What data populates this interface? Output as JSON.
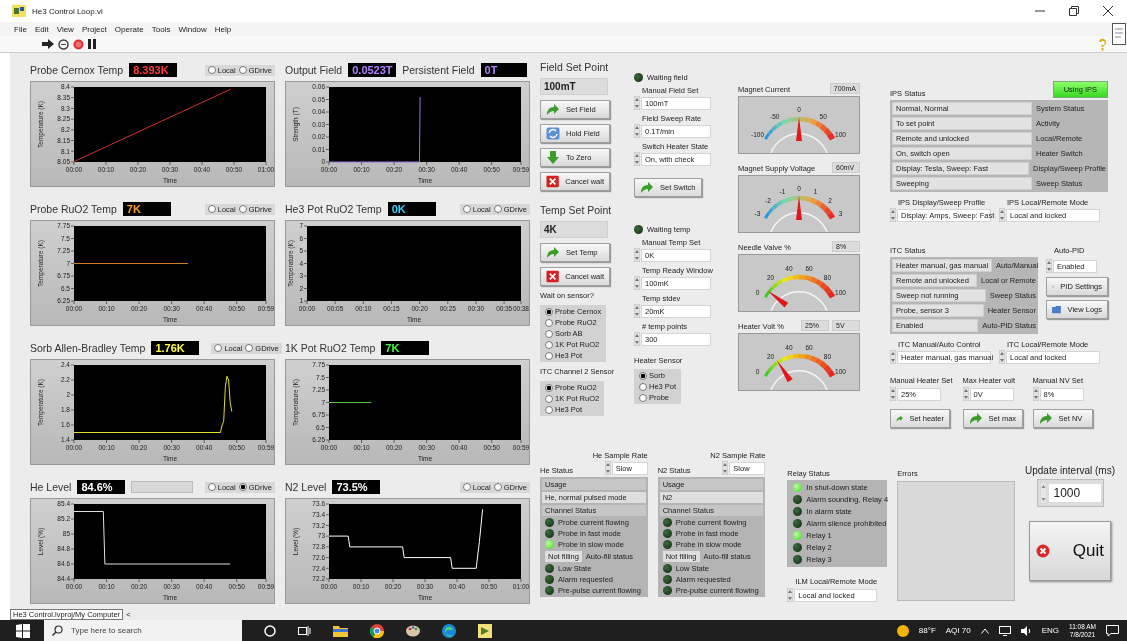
{
  "window": {
    "title": "He3 Control Loop.vi"
  },
  "menu": [
    "File",
    "Edit",
    "View",
    "Project",
    "Operate",
    "Tools",
    "Window",
    "Help"
  ],
  "charts": [
    {
      "title": "Probe Cernox Temp",
      "value": "8.393K",
      "source": [
        {
          "label": "Local",
          "selected": false
        },
        {
          "label": "GDrive",
          "selected": false
        }
      ],
      "chart_data": {
        "type": "line",
        "xlabel": "Time",
        "ylabel": "Temperature (K)",
        "x": [
          0,
          49
        ],
        "series": [
          {
            "color": "#d03030",
            "values": [
              8.052,
              8.39
            ]
          }
        ],
        "xlim": [
          0,
          60
        ],
        "ylim": [
          8.05,
          8.4
        ],
        "xticks": [
          {
            "value": 0,
            "label": "00:00"
          },
          {
            "value": 10,
            "label": "00:10"
          },
          {
            "value": 20,
            "label": "00:20"
          },
          {
            "value": 30,
            "label": "00:30"
          },
          {
            "value": 40,
            "label": "00:40"
          },
          {
            "value": 50,
            "label": "00:50"
          },
          {
            "value": 60,
            "label": "01:00"
          }
        ],
        "yticks": [
          8.05,
          8.1,
          8.15,
          8.2,
          8.25,
          8.3,
          8.35,
          8.4
        ]
      }
    },
    {
      "title": "Output Field",
      "value": "0.0523T",
      "extra": {
        "label": "Persistent Field",
        "value": "0T"
      },
      "chart_data": {
        "type": "line",
        "xlabel": "Time",
        "ylabel": "Strength (T)",
        "x": [
          0,
          27.8,
          28
        ],
        "series": [
          {
            "color": "#a070e0",
            "values": [
              0,
              0,
              0.052
            ]
          }
        ],
        "xlim": [
          0,
          59
        ],
        "ylim": [
          0,
          0.06
        ],
        "xticks": [
          {
            "value": 0,
            "label": "00:00"
          },
          {
            "value": 10,
            "label": "00:10"
          },
          {
            "value": 20,
            "label": "00:20"
          },
          {
            "value": 30,
            "label": "00:30"
          },
          {
            "value": 40,
            "label": "00:40"
          },
          {
            "value": 50,
            "label": "00:50"
          },
          {
            "value": 59,
            "label": "00:59"
          }
        ],
        "yticks": [
          0,
          0.01,
          0.02,
          0.03,
          0.04,
          0.05,
          0.06
        ]
      }
    },
    {
      "title": "Probe RuO2 Temp",
      "value": "7K",
      "source": [
        {
          "label": "Local",
          "selected": false
        },
        {
          "label": "GDrive",
          "selected": false
        }
      ],
      "chart_data": {
        "type": "line",
        "xlabel": "Time",
        "ylabel": "Temperature (K)",
        "x": [
          0,
          35
        ],
        "series": [
          {
            "color": "#d08020",
            "values": [
              7,
              7
            ]
          }
        ],
        "xlim": [
          0,
          59
        ],
        "ylim": [
          6.25,
          7.75
        ],
        "xticks": [
          {
            "value": 0,
            "label": "00:00"
          },
          {
            "value": 10,
            "label": "00:10"
          },
          {
            "value": 20,
            "label": "00:20"
          },
          {
            "value": 30,
            "label": "00:30"
          },
          {
            "value": 40,
            "label": "00:40"
          },
          {
            "value": 50,
            "label": "00:50"
          },
          {
            "value": 59,
            "label": "00:59"
          }
        ],
        "yticks": [
          6.25,
          6.5,
          6.75,
          7,
          7.25,
          7.5,
          7.75
        ]
      }
    },
    {
      "title": "He3 Pot RuO2 Temp",
      "value": "0K",
      "source": [
        {
          "label": "Local",
          "selected": false
        },
        {
          "label": "GDrive",
          "selected": false
        }
      ],
      "chart_data": {
        "type": "line",
        "xlabel": "Time",
        "ylabel": "Temperature (K)",
        "xlim": [
          0,
          38
        ],
        "ylim": [
          1,
          7
        ],
        "xticks": [
          {
            "value": 0,
            "label": "00:00"
          },
          {
            "value": 5,
            "label": "00:05"
          },
          {
            "value": 10,
            "label": "00:10"
          },
          {
            "value": 15,
            "label": "00:15"
          },
          {
            "value": 20,
            "label": "00:20"
          },
          {
            "value": 25,
            "label": "00:25"
          },
          {
            "value": 30,
            "label": "00:30"
          },
          {
            "value": 35,
            "label": "00:35"
          },
          {
            "value": 38,
            "label": "00:38"
          }
        ],
        "yticks": [
          1,
          2,
          3,
          4,
          5,
          6,
          7
        ]
      }
    },
    {
      "title": "Sorb Allen-Bradley Temp",
      "value": "1.76K",
      "source": [
        {
          "label": "Local",
          "selected": false
        },
        {
          "label": "GDrive",
          "selected": false
        }
      ],
      "chart_data": {
        "type": "line",
        "xlabel": "Time",
        "ylabel": "Temperature (K)",
        "x": [
          0,
          45,
          45.5,
          46,
          46.5,
          47,
          47.5,
          48,
          48.5
        ],
        "series": [
          {
            "color": "#e0e020",
            "values": [
              1.5,
              1.5,
              1.6,
              1.65,
              2.1,
              2.25,
              2.2,
              1.9,
              1.78
            ]
          }
        ],
        "xlim": [
          0,
          59
        ],
        "ylim": [
          1.4,
          2.4
        ],
        "xticks": [
          {
            "value": 0,
            "label": "00:00"
          },
          {
            "value": 10,
            "label": "00:10"
          },
          {
            "value": 20,
            "label": "00:20"
          },
          {
            "value": 30,
            "label": "00:30"
          },
          {
            "value": 40,
            "label": "00:40"
          },
          {
            "value": 50,
            "label": "00:50"
          },
          {
            "value": 59,
            "label": "00:59"
          }
        ],
        "yticks": [
          1.4,
          1.6,
          1.8,
          2,
          2.2,
          2.4
        ]
      }
    },
    {
      "title": "1K Pot RuO2 Temp",
      "value": "7K",
      "chart_data": {
        "type": "line",
        "xlabel": "Time",
        "ylabel": "Temperature (K)",
        "x": [
          0,
          13
        ],
        "series": [
          {
            "color": "#60c040",
            "values": [
              7,
              7
            ]
          }
        ],
        "xlim": [
          0,
          59
        ],
        "ylim": [
          6.25,
          7.75
        ],
        "xticks": [
          {
            "value": 0,
            "label": "00:00"
          },
          {
            "value": 10,
            "label": "00:10"
          },
          {
            "value": 20,
            "label": "00:20"
          },
          {
            "value": 30,
            "label": "00:30"
          },
          {
            "value": 40,
            "label": "00:40"
          },
          {
            "value": 50,
            "label": "00:50"
          },
          {
            "value": 59,
            "label": "00:59"
          }
        ],
        "yticks": [
          6.25,
          6.5,
          6.75,
          7,
          7.25,
          7.5,
          7.75
        ]
      }
    },
    {
      "title": "He Level",
      "value": "84.6%",
      "level_bar": {
        "level": 0
      },
      "source": [
        {
          "label": "Local",
          "selected": false
        },
        {
          "label": "GDrive",
          "selected": true
        }
      ],
      "chart_data": {
        "type": "line",
        "xlabel": "Time",
        "ylabel": "Level (%)",
        "x": [
          0,
          9,
          9.5,
          48
        ],
        "series": [
          {
            "color": "#e0e0e0",
            "values": [
              85.3,
              85.3,
              84.6,
              84.6
            ]
          }
        ],
        "xlim": [
          0,
          59
        ],
        "ylim": [
          84.4,
          85.4
        ],
        "xticks": [
          {
            "value": 0,
            "label": "00:00"
          },
          {
            "value": 10,
            "label": "00:10"
          },
          {
            "value": 20,
            "label": "00:20"
          },
          {
            "value": 30,
            "label": "00:30"
          },
          {
            "value": 40,
            "label": "00:40"
          },
          {
            "value": 50,
            "label": "00:50"
          },
          {
            "value": 59,
            "label": "00:59"
          }
        ],
        "yticks": [
          84.4,
          84.6,
          84.8,
          85,
          85.2,
          85.4
        ]
      }
    },
    {
      "title": "N2 Level",
      "value": "73.5%",
      "source": [
        {
          "label": "Local",
          "selected": false
        },
        {
          "label": "GDrive",
          "selected": false
        }
      ],
      "chart_data": {
        "type": "line",
        "xlabel": "Time",
        "ylabel": "Level (%)",
        "x": [
          0,
          6,
          6.5,
          23,
          23.5,
          38,
          38.5,
          46,
          47,
          48
        ],
        "series": [
          {
            "color": "#ffffff",
            "values": [
              73,
              73,
              72.8,
              72.8,
              72.6,
              72.6,
              72.4,
              72.4,
              72.9,
              73.5
            ]
          }
        ],
        "xlim": [
          0,
          60
        ],
        "ylim": [
          72.2,
          73.6
        ],
        "xticks": [
          {
            "value": 0,
            "label": "00:00"
          },
          {
            "value": 10,
            "label": "00:10"
          },
          {
            "value": 20,
            "label": "00:20"
          },
          {
            "value": 30,
            "label": "00:30"
          },
          {
            "value": 40,
            "label": "00:40"
          },
          {
            "value": 50,
            "label": "00:50"
          },
          {
            "value": 60,
            "label": "01:00"
          }
        ],
        "yticks": [
          72.2,
          72.4,
          72.6,
          72.8,
          73,
          73.2,
          73.4,
          73.6
        ]
      }
    }
  ],
  "field_set_point": {
    "title": "Field Set Point",
    "value": "100mT",
    "buttons": [
      {
        "label": "Set Field"
      },
      {
        "label": "Hold Field"
      },
      {
        "label": "To Zero"
      },
      {
        "label": "Cancel wait"
      }
    ]
  },
  "temp_set_point": {
    "title": "Temp Set Point",
    "value": "4K",
    "buttons": [
      {
        "label": "Set Temp"
      },
      {
        "label": "Cancel wait"
      }
    ]
  },
  "wait_on_sensor": {
    "label": "Wait on sensor?",
    "options": [
      {
        "label": "Probe Cernox",
        "selected": true
      },
      {
        "label": "Probe RuO2",
        "selected": false
      },
      {
        "label": "Sorb AB",
        "selected": false
      },
      {
        "label": "1K Pot RuO2",
        "selected": false
      },
      {
        "label": "He3 Pot",
        "selected": false
      }
    ]
  },
  "itc_channel_2_sensor": {
    "label": "ITC Channel 2 Sensor",
    "options": [
      {
        "label": "Probe RuO2",
        "selected": true
      },
      {
        "label": "1K Pot RuO2",
        "selected": false
      },
      {
        "label": "He3 Pot",
        "selected": false
      }
    ]
  },
  "field_controls": {
    "indicator": {
      "label": "Waiting field",
      "on": false
    },
    "inputs": [
      {
        "label": "Manual Field Set",
        "value": "100mT"
      },
      {
        "label": "Field Sweep Rate",
        "value": "0.1T/min"
      },
      {
        "label": "Switch Heater State",
        "value": "On, with check"
      }
    ],
    "button": {
      "label": "Set Switch"
    }
  },
  "temp_controls": {
    "indicator": {
      "label": "Waiting temp",
      "on": false
    },
    "inputs": [
      {
        "label": "Manual Temp Set",
        "value": "0K"
      },
      {
        "label": "Temp Ready Window",
        "value": "100mK"
      },
      {
        "label": "Temp stdev",
        "value": "20mK"
      },
      {
        "label": "# temp points",
        "value": "300"
      }
    ]
  },
  "heater_sensor": {
    "label": "Heater Sensor",
    "options": [
      {
        "label": "Sorb",
        "selected": true
      },
      {
        "label": "He3 Pot",
        "selected": false
      },
      {
        "label": "Probe",
        "selected": false
      }
    ]
  },
  "gauges": [
    {
      "label": "Magnet Current",
      "kind": "bipolar",
      "readings": [
        "700mA"
      ],
      "scale": [
        "-100",
        "-50",
        "0",
        "50",
        "100"
      ]
    },
    {
      "label": "Magnet Supply Voltage",
      "kind": "bipolar",
      "readings": [
        "60mV"
      ],
      "scale": [
        "-3",
        "-2",
        "-1",
        "0",
        "1",
        "2",
        "3"
      ]
    },
    {
      "label": "Needle Valve %",
      "kind": "unipolar",
      "readings": [
        "8%"
      ],
      "scale": [
        "0",
        "20",
        "40",
        "60",
        "80",
        "100"
      ]
    },
    {
      "label": "Heater Volt %",
      "kind": "unipolar",
      "readings": [
        "25%",
        "5V"
      ],
      "scale": [
        "0",
        "20",
        "40",
        "60",
        "80",
        "100"
      ]
    }
  ],
  "ips": {
    "title": "IPS Status",
    "button": {
      "label": "Using IPS",
      "on": true
    },
    "status": [
      {
        "value": "Normal, Normal",
        "label": "System Status"
      },
      {
        "value": "To set point",
        "label": "Activity"
      },
      {
        "value": "Remote and unlocked",
        "label": "Local/Remote"
      },
      {
        "value": "On, switch open",
        "label": "Heater Switch"
      },
      {
        "value": "Display: Tesla, Sweep: Fast",
        "label": "Display/Sweep Profile"
      },
      {
        "value": "Sweeping",
        "label": "Sweep Status"
      }
    ],
    "selectors": [
      {
        "label": "IPS Display/Sweep Profile",
        "value": "Display: Amps, Sweep: Fast"
      },
      {
        "label": "IPS Local/Remote Mode",
        "value": "Local and locked"
      }
    ]
  },
  "itc": {
    "title": "ITC Status",
    "status": [
      {
        "value": "Heater manual, gas manual",
        "label": "Auto/Manual"
      },
      {
        "value": "Remote and unlocked",
        "label": "Local or Remote"
      },
      {
        "value": "Sweep not running",
        "label": "Sweep Status"
      },
      {
        "value": "Probe, sensor 3",
        "label": "Heater Sensor"
      },
      {
        "value": "Enabled",
        "label": "Auto-PID Status"
      }
    ],
    "auto_pid": {
      "label": "Auto-PID",
      "value": "Enabled"
    },
    "buttons": [
      {
        "label": "PID Settings"
      },
      {
        "label": "View Logs"
      }
    ],
    "selectors": [
      {
        "label": "ITC Manual/Auto Control",
        "value": "Heater manual, gas manual"
      },
      {
        "label": "ITC Local/Remote Mode",
        "value": "Local and locked"
      }
    ],
    "sets": [
      {
        "label": "Manual Heater Set",
        "value": "25%",
        "button": "Set heater"
      },
      {
        "label": "Max Heater volt",
        "value": "0V",
        "button": "Set max"
      },
      {
        "label": "Manual NV Set",
        "value": "8%",
        "button": "Set NV"
      }
    ]
  },
  "ilm": [
    {
      "title": "He Status",
      "rate": {
        "label": "He Sample Rate",
        "value": "Slow"
      },
      "usage_label": "Usage",
      "usage": "He, normal pulsed mode",
      "channel_label": "Channel Status",
      "channel": [
        {
          "label": "Probe current flowing",
          "on": false
        },
        {
          "label": "Probe in fast mode",
          "on": false
        },
        {
          "label": "Probe in slow mode",
          "on": true
        }
      ],
      "fill": {
        "value": "Not filling",
        "label": "Auto-fill status"
      },
      "alarms": [
        {
          "label": "Low State",
          "on": false
        },
        {
          "label": "Alarm requested",
          "on": false
        },
        {
          "label": "Pre-pulse current flowing",
          "on": false
        }
      ]
    },
    {
      "title": "N2 Status",
      "rate": {
        "label": "N2 Sample Rate",
        "value": "Slow"
      },
      "usage_label": "Usage",
      "usage": "N2",
      "channel_label": "Channel Status",
      "channel": [
        {
          "label": "Probe current flowing",
          "on": false
        },
        {
          "label": "Probe in fast mode",
          "on": false
        },
        {
          "label": "Probe in slow mode",
          "on": false
        }
      ],
      "fill": {
        "value": "Not filling",
        "label": "Auto-fill status"
      },
      "alarms": [
        {
          "label": "Low State",
          "on": false
        },
        {
          "label": "Alarm requested",
          "on": false
        },
        {
          "label": "Pre-pulse current flowing",
          "on": false
        }
      ]
    }
  ],
  "relay": {
    "title": "Relay Status",
    "items": [
      {
        "label": "In shut-down state",
        "on": true
      },
      {
        "label": "Alarm sounding, Relay 4",
        "on": false
      },
      {
        "label": "In alarm state",
        "on": false
      },
      {
        "label": "Alarm silence prohibited",
        "on": false
      },
      {
        "label": "Relay 1",
        "on": true
      },
      {
        "label": "Relay 2",
        "on": false
      },
      {
        "label": "Relay 3",
        "on": false
      }
    ]
  },
  "ilm_mode": {
    "label": "ILM Local/Remote Mode",
    "value": "Local and locked"
  },
  "errors": {
    "label": "Errors"
  },
  "update_interval": {
    "label": "Update interval (ms)",
    "value": "1000"
  },
  "quit": {
    "label": "Quit"
  },
  "status_bar": {
    "path": "He3 Control.lvproj/My Computer",
    "arrow": "<"
  },
  "taskbar": {
    "search_placeholder": "Type here to search",
    "temperature": "88°F",
    "air_quality": "AQI 70",
    "language": "ENG",
    "time": "11:08 AM",
    "date": "7/8/2021"
  }
}
